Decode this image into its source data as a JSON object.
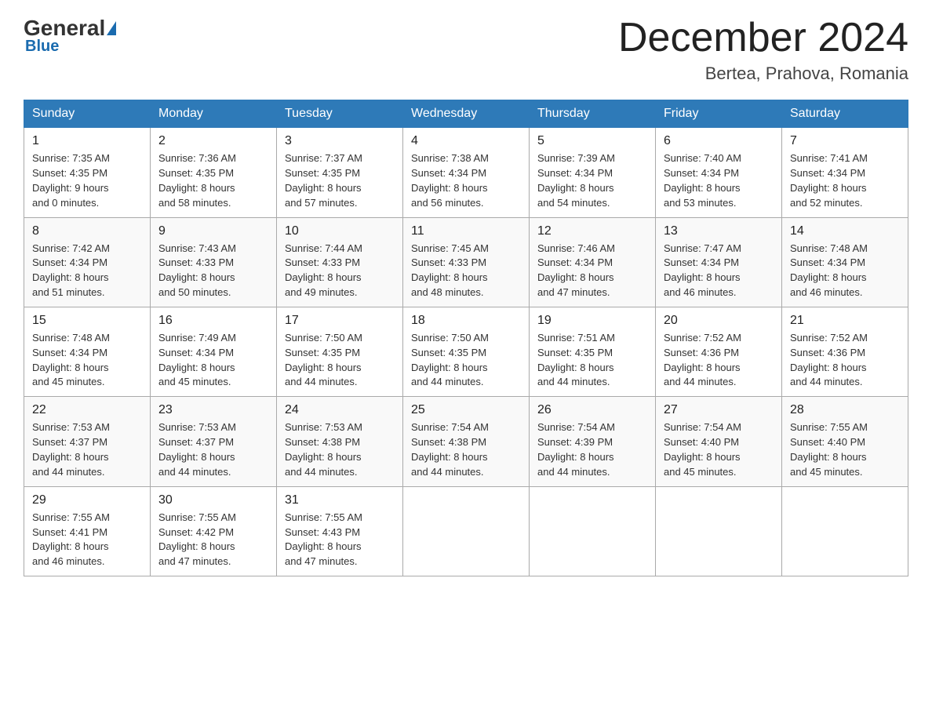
{
  "header": {
    "logo_general": "General",
    "logo_blue": "Blue",
    "month_title": "December 2024",
    "location": "Bertea, Prahova, Romania"
  },
  "days_of_week": [
    "Sunday",
    "Monday",
    "Tuesday",
    "Wednesday",
    "Thursday",
    "Friday",
    "Saturday"
  ],
  "weeks": [
    [
      {
        "day": "1",
        "sunrise": "7:35 AM",
        "sunset": "4:35 PM",
        "daylight": "9 hours and 0 minutes."
      },
      {
        "day": "2",
        "sunrise": "7:36 AM",
        "sunset": "4:35 PM",
        "daylight": "8 hours and 58 minutes."
      },
      {
        "day": "3",
        "sunrise": "7:37 AM",
        "sunset": "4:35 PM",
        "daylight": "8 hours and 57 minutes."
      },
      {
        "day": "4",
        "sunrise": "7:38 AM",
        "sunset": "4:34 PM",
        "daylight": "8 hours and 56 minutes."
      },
      {
        "day": "5",
        "sunrise": "7:39 AM",
        "sunset": "4:34 PM",
        "daylight": "8 hours and 54 minutes."
      },
      {
        "day": "6",
        "sunrise": "7:40 AM",
        "sunset": "4:34 PM",
        "daylight": "8 hours and 53 minutes."
      },
      {
        "day": "7",
        "sunrise": "7:41 AM",
        "sunset": "4:34 PM",
        "daylight": "8 hours and 52 minutes."
      }
    ],
    [
      {
        "day": "8",
        "sunrise": "7:42 AM",
        "sunset": "4:34 PM",
        "daylight": "8 hours and 51 minutes."
      },
      {
        "day": "9",
        "sunrise": "7:43 AM",
        "sunset": "4:33 PM",
        "daylight": "8 hours and 50 minutes."
      },
      {
        "day": "10",
        "sunrise": "7:44 AM",
        "sunset": "4:33 PM",
        "daylight": "8 hours and 49 minutes."
      },
      {
        "day": "11",
        "sunrise": "7:45 AM",
        "sunset": "4:33 PM",
        "daylight": "8 hours and 48 minutes."
      },
      {
        "day": "12",
        "sunrise": "7:46 AM",
        "sunset": "4:34 PM",
        "daylight": "8 hours and 47 minutes."
      },
      {
        "day": "13",
        "sunrise": "7:47 AM",
        "sunset": "4:34 PM",
        "daylight": "8 hours and 46 minutes."
      },
      {
        "day": "14",
        "sunrise": "7:48 AM",
        "sunset": "4:34 PM",
        "daylight": "8 hours and 46 minutes."
      }
    ],
    [
      {
        "day": "15",
        "sunrise": "7:48 AM",
        "sunset": "4:34 PM",
        "daylight": "8 hours and 45 minutes."
      },
      {
        "day": "16",
        "sunrise": "7:49 AM",
        "sunset": "4:34 PM",
        "daylight": "8 hours and 45 minutes."
      },
      {
        "day": "17",
        "sunrise": "7:50 AM",
        "sunset": "4:35 PM",
        "daylight": "8 hours and 44 minutes."
      },
      {
        "day": "18",
        "sunrise": "7:50 AM",
        "sunset": "4:35 PM",
        "daylight": "8 hours and 44 minutes."
      },
      {
        "day": "19",
        "sunrise": "7:51 AM",
        "sunset": "4:35 PM",
        "daylight": "8 hours and 44 minutes."
      },
      {
        "day": "20",
        "sunrise": "7:52 AM",
        "sunset": "4:36 PM",
        "daylight": "8 hours and 44 minutes."
      },
      {
        "day": "21",
        "sunrise": "7:52 AM",
        "sunset": "4:36 PM",
        "daylight": "8 hours and 44 minutes."
      }
    ],
    [
      {
        "day": "22",
        "sunrise": "7:53 AM",
        "sunset": "4:37 PM",
        "daylight": "8 hours and 44 minutes."
      },
      {
        "day": "23",
        "sunrise": "7:53 AM",
        "sunset": "4:37 PM",
        "daylight": "8 hours and 44 minutes."
      },
      {
        "day": "24",
        "sunrise": "7:53 AM",
        "sunset": "4:38 PM",
        "daylight": "8 hours and 44 minutes."
      },
      {
        "day": "25",
        "sunrise": "7:54 AM",
        "sunset": "4:38 PM",
        "daylight": "8 hours and 44 minutes."
      },
      {
        "day": "26",
        "sunrise": "7:54 AM",
        "sunset": "4:39 PM",
        "daylight": "8 hours and 44 minutes."
      },
      {
        "day": "27",
        "sunrise": "7:54 AM",
        "sunset": "4:40 PM",
        "daylight": "8 hours and 45 minutes."
      },
      {
        "day": "28",
        "sunrise": "7:55 AM",
        "sunset": "4:40 PM",
        "daylight": "8 hours and 45 minutes."
      }
    ],
    [
      {
        "day": "29",
        "sunrise": "7:55 AM",
        "sunset": "4:41 PM",
        "daylight": "8 hours and 46 minutes."
      },
      {
        "day": "30",
        "sunrise": "7:55 AM",
        "sunset": "4:42 PM",
        "daylight": "8 hours and 47 minutes."
      },
      {
        "day": "31",
        "sunrise": "7:55 AM",
        "sunset": "4:43 PM",
        "daylight": "8 hours and 47 minutes."
      },
      null,
      null,
      null,
      null
    ]
  ]
}
